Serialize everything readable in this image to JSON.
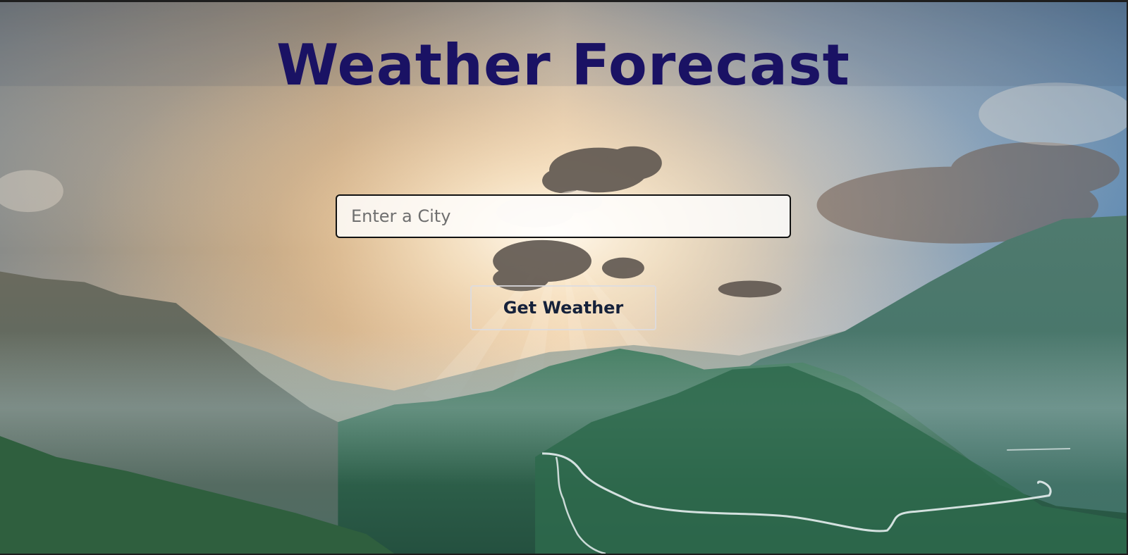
{
  "page": {
    "title": "Weather Forecast"
  },
  "search": {
    "placeholder": "Enter a City",
    "value": ""
  },
  "actions": {
    "get_weather_label": "Get Weather"
  },
  "colors": {
    "title": "#1a1264",
    "button_text": "#15213a",
    "sky_glow": "#f6d7a8",
    "sky_blue": "#6f92b5",
    "mountain_green": "#2f6a52"
  }
}
